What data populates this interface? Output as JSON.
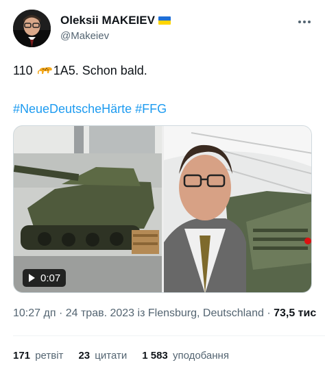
{
  "author": {
    "name": "Oleksii MAKEIEV",
    "handle": "@Makeiev",
    "flag_colors": [
      "#1f6fd6",
      "#ffd500"
    ]
  },
  "tweet": {
    "text_prefix": "110",
    "emoji_icon": "leopard-icon",
    "text_suffix": "1A5. Schon bald.",
    "hashtags": [
      "#NeueDeutscheHärte",
      "#FFG"
    ]
  },
  "media": {
    "left_image": "tank-in-hangar-photo",
    "right_image": "selfie-with-tank-photo",
    "video_duration": "0:07"
  },
  "meta": {
    "time": "10:27 дп",
    "separator": "·",
    "date": "24 трав. 2023",
    "location_prefix": "із",
    "location": "Flensburg, Deutschland",
    "views": "73,5 тис"
  },
  "stats": {
    "retweets_count": "171",
    "retweets_label": "ретвіт",
    "quotes_count": "23",
    "quotes_label": "цитати",
    "likes_count": "1 583",
    "likes_label": "уподобання"
  },
  "colors": {
    "link": "#1d9bf0",
    "secondary_text": "#536471",
    "primary_text": "#0f1419"
  }
}
